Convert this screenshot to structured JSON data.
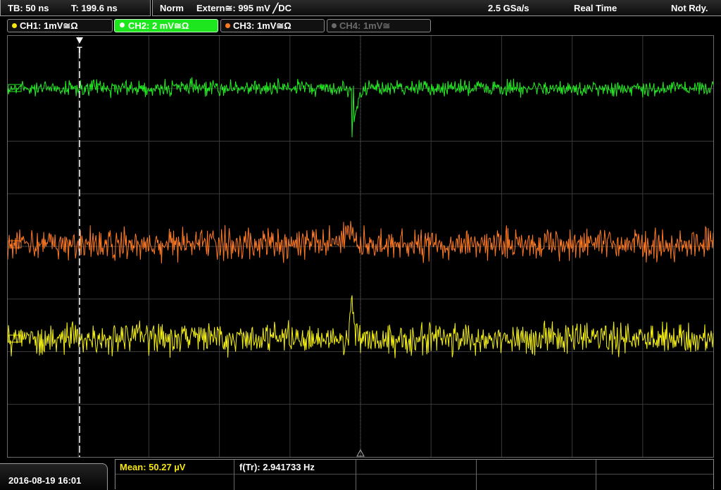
{
  "status": {
    "timebase": "TB: 50 ns",
    "trigger_time": "T: 199.6 ns",
    "mode": "Norm",
    "trigger_source": "Extern≅: 995 mV ╱DC",
    "sample_rate": "2.5 GSa/s",
    "acq_mode": "Real Time",
    "state": "Not Rdy."
  },
  "channels": [
    {
      "label": "CH1: 1mV≅Ω",
      "color": "#f5e614",
      "active": false,
      "enabled": true
    },
    {
      "label": "CH2: 2 mV≅Ω",
      "color": "#1ee61e",
      "active": true,
      "enabled": true
    },
    {
      "label": "CH3: 1mV≅Ω",
      "color": "#ff7a1e",
      "active": false,
      "enabled": true
    },
    {
      "label": "CH4: 1mV≅",
      "color": "#6a6a6a",
      "active": false,
      "enabled": false
    }
  ],
  "trigger_marker": "T",
  "traces": {
    "ch2": {
      "color": "#22ee22",
      "level": "upper",
      "noise": "low",
      "event": "negative dip"
    },
    "ch3": {
      "color": "#ff7a24",
      "level": "middle",
      "noise": "high",
      "event": "small positive bump"
    },
    "ch1": {
      "color": "#f5f014",
      "level": "lower",
      "noise": "high",
      "event": "positive spike"
    }
  },
  "grid": {
    "h_divisions": 10,
    "v_divisions": 8,
    "color": "#3a3a3a"
  },
  "bottom": {
    "datetime": "2016-08-19 16:01",
    "mean": "Mean: 50.27 µV",
    "freq": "f(Tr): 2.941733 Hz",
    "mean_color": "#f5e614"
  }
}
